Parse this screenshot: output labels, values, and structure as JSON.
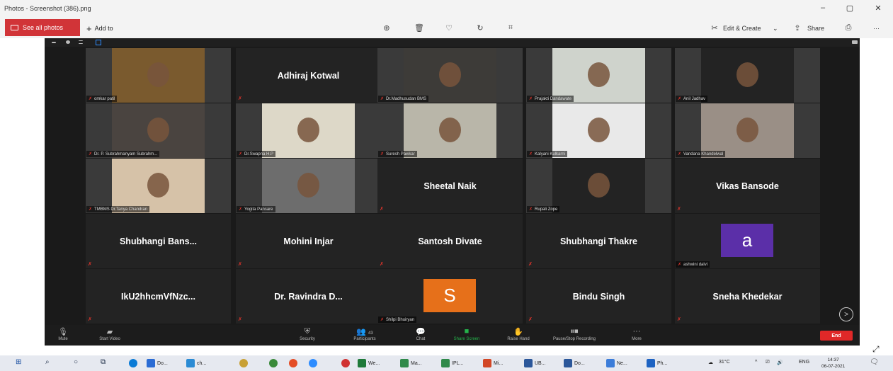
{
  "window": {
    "title": "Photos - Screenshot (386).png",
    "controls": {
      "minimize": "–",
      "maximize": "▢",
      "close": "✕"
    }
  },
  "toolbar": {
    "see_all": "See all photos",
    "add_to": "Add to",
    "edit_create": "Edit & Create",
    "share": "Share",
    "more": "···"
  },
  "tiles": [
    {
      "kind": "video",
      "label": "omkar patil",
      "bg": "#7a5a2e"
    },
    {
      "kind": "name",
      "name": "Adhiraj Kotwal"
    },
    {
      "kind": "video",
      "label": "Dr.Madhusudan BMS",
      "bg": "#3d3b38"
    },
    {
      "kind": "video",
      "label": "Prajakti Dandawate",
      "bg": "#cfd3cc"
    },
    {
      "kind": "video",
      "label": "Anil Jadhav",
      "bg": "#232323"
    },
    {
      "kind": "video",
      "label": "Dr. P. Subrahmanyam Subrahm...",
      "bg": "#4a4440"
    },
    {
      "kind": "video",
      "label": "Dr.Swapna H.P",
      "bg": "#ddd8c8"
    },
    {
      "kind": "video",
      "label": "Suresh Pawkar",
      "bg": "#b9b6a9"
    },
    {
      "kind": "video",
      "label": "Kalyani Kulkarni",
      "bg": "#e9e9e9"
    },
    {
      "kind": "video",
      "label": "Vandana Khandelwal",
      "bg": "#9a8f86"
    },
    {
      "kind": "video",
      "label": "TMBMS Dr.Tanya Chandran",
      "bg": "#d6c2a8"
    },
    {
      "kind": "video",
      "label": "Yogita Pansare",
      "bg": "#6d6d6d"
    },
    {
      "kind": "name",
      "name": "Sheetal Naik"
    },
    {
      "kind": "video",
      "label": "Rupali Zope",
      "bg": "#232323"
    },
    {
      "kind": "name",
      "name": "Vikas Bansode"
    },
    {
      "kind": "name",
      "name": "Shubhangi  Bans..."
    },
    {
      "kind": "name",
      "name": "Mohini Injar"
    },
    {
      "kind": "name",
      "name": "Santosh Divate"
    },
    {
      "kind": "name",
      "name": "Shubhangi Thakre"
    },
    {
      "kind": "avatar",
      "letter": "a",
      "label": "ashwini dalvi",
      "color": "#5b2fa8"
    },
    {
      "kind": "name",
      "name": "IkU2hhcmVfNzc..."
    },
    {
      "kind": "name",
      "name": "Dr. Ravindra D..."
    },
    {
      "kind": "avatar",
      "letter": "S",
      "label": "Shilpi Bhuiryan",
      "color": "#e6701a"
    },
    {
      "kind": "name",
      "name": "Bindu Singh"
    },
    {
      "kind": "name",
      "name": "Sneha Khedekar"
    }
  ],
  "controls": {
    "mute": "Mute",
    "start_video": "Start Video",
    "security": "Security",
    "participants": "Participants",
    "participants_count": "43",
    "chat": "Chat",
    "share_screen": "Share Screen",
    "raise_hand": "Raise Hand",
    "pause_recording": "Pause/Stop Recording",
    "more": "More",
    "end": "End"
  },
  "taskbar": {
    "apps": [
      {
        "label": "Do...",
        "color": "#2b6cd4"
      },
      {
        "label": "ch...",
        "color": "#2b8bd4"
      },
      {
        "label": "We...",
        "color": "#1f7a3a"
      },
      {
        "label": "Ma...",
        "color": "#2f8a4a"
      },
      {
        "label": "IPL...",
        "color": "#2f8a4a"
      },
      {
        "label": "Mi...",
        "color": "#d24726"
      },
      {
        "label": "UB...",
        "color": "#2b579a"
      },
      {
        "label": "Do...",
        "color": "#2b579a"
      },
      {
        "label": "Ne...",
        "color": "#3c7dd9"
      },
      {
        "label": "Ph...",
        "color": "#1e63c2"
      }
    ],
    "weather": "31°C",
    "lang": "ENG",
    "time": "14:37",
    "date": "06-07-2021"
  }
}
